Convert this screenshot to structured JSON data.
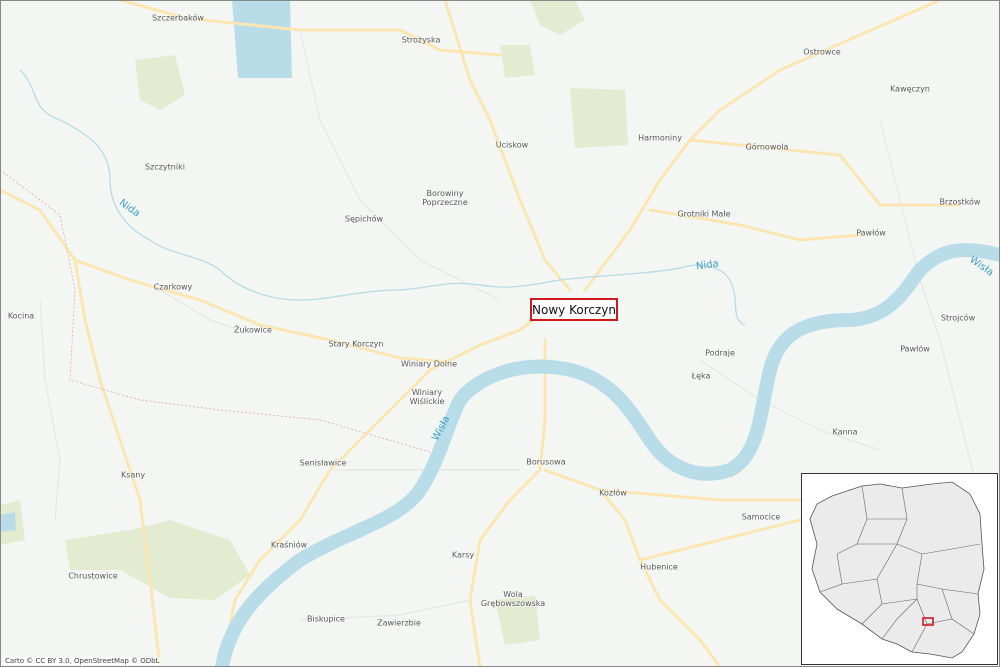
{
  "map": {
    "center_marker": "Nowy Korczyn",
    "rivers": [
      "Nida",
      "Nida",
      "Wisła",
      "Wisła"
    ],
    "places": [
      "Szczerbaków",
      "Strożyska",
      "Ostrowce",
      "Kawęczyn",
      "Harmoniny",
      "Uciskow",
      "Górnowola",
      "Szczytniki",
      "Borowiny Poprzeczne",
      "Sępichów",
      "Grotniki Małe",
      "Brzostków",
      "Pawłów",
      "Czarkowy",
      "Kocina",
      "Żukowice",
      "Stary Korczyn",
      "Winiary Dolne",
      "Winiary Wiślickie",
      "Podraje",
      "Łęka",
      "Strojców",
      "Pawłów",
      "Kanna",
      "Senisławice",
      "Ksany",
      "Borusowa",
      "Kozłów",
      "Samocice",
      "Kraśniów",
      "Karsy",
      "Chrustowice",
      "Wola Grębowszowska",
      "Hubenice",
      "Biskupice",
      "Zawierzbie"
    ],
    "attribution": "Carto © CC BY 3.0, OpenStreetMap © ODbL"
  },
  "inset": {
    "country": "Poland",
    "highlight_color": "#d0191d"
  },
  "colors": {
    "water": "#b9dde8",
    "water_label": "#3aa0c6",
    "road": "#fbe6b2",
    "park": "#e6eed2",
    "marker_border": "#d0191d"
  }
}
